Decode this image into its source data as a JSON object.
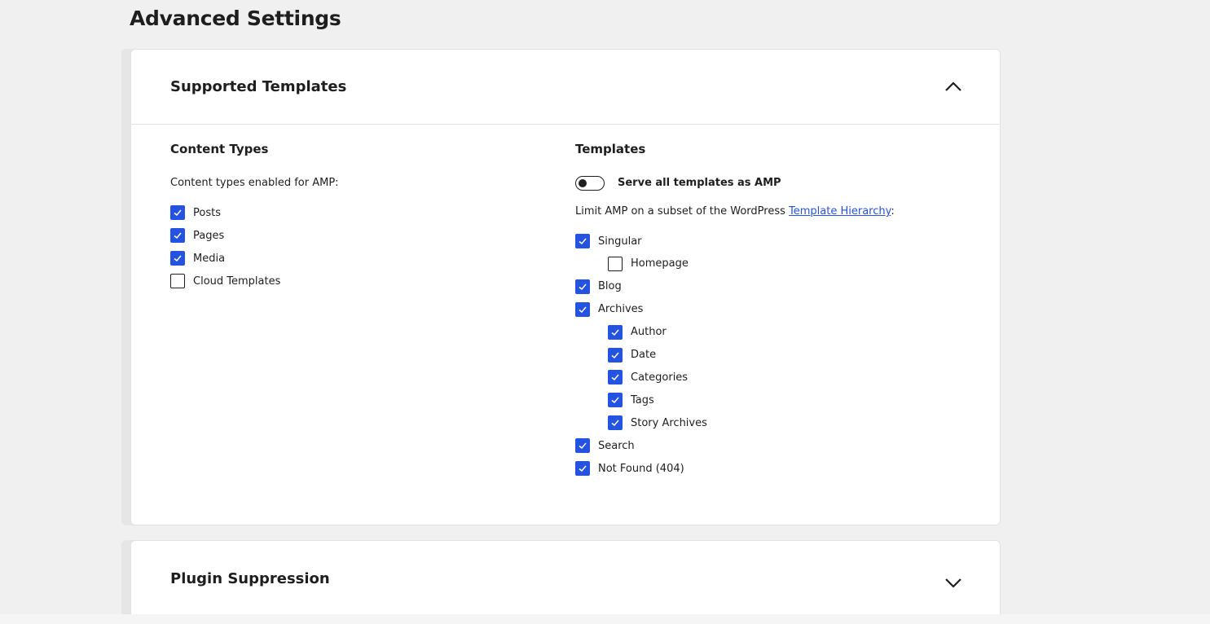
{
  "page": {
    "title": "Advanced Settings"
  },
  "supported_templates": {
    "title": "Supported Templates",
    "expanded": true,
    "content_types": {
      "title": "Content Types",
      "description": "Content types enabled for AMP:",
      "items": [
        {
          "label": "Posts",
          "checked": true
        },
        {
          "label": "Pages",
          "checked": true
        },
        {
          "label": "Media",
          "checked": true
        },
        {
          "label": "Cloud Templates",
          "checked": false
        }
      ]
    },
    "templates": {
      "title": "Templates",
      "toggle_label": "Serve all templates as AMP",
      "toggle_on": false,
      "description_prefix": "Limit AMP on a subset of the WordPress ",
      "description_link": "Template Hierarchy",
      "description_suffix": ":",
      "items": [
        {
          "label": "Singular",
          "checked": true,
          "level": 0
        },
        {
          "label": "Homepage",
          "checked": false,
          "level": 1
        },
        {
          "label": "Blog",
          "checked": true,
          "level": 0
        },
        {
          "label": "Archives",
          "checked": true,
          "level": 0
        },
        {
          "label": "Author",
          "checked": true,
          "level": 1
        },
        {
          "label": "Date",
          "checked": true,
          "level": 1
        },
        {
          "label": "Categories",
          "checked": true,
          "level": 1
        },
        {
          "label": "Tags",
          "checked": true,
          "level": 1
        },
        {
          "label": "Story Archives",
          "checked": true,
          "level": 1
        },
        {
          "label": "Search",
          "checked": true,
          "level": 0
        },
        {
          "label": "Not Found (404)",
          "checked": true,
          "level": 0
        }
      ]
    }
  },
  "plugin_suppression": {
    "title": "Plugin Suppression",
    "expanded": false
  },
  "colors": {
    "accent": "#2453e2",
    "background": "#f0f0f0",
    "panel": "#ffffff",
    "text": "#1e1e1e"
  },
  "icons": {
    "collapse": "chevron-up-icon",
    "expand": "chevron-down-icon",
    "check": "check-icon"
  }
}
